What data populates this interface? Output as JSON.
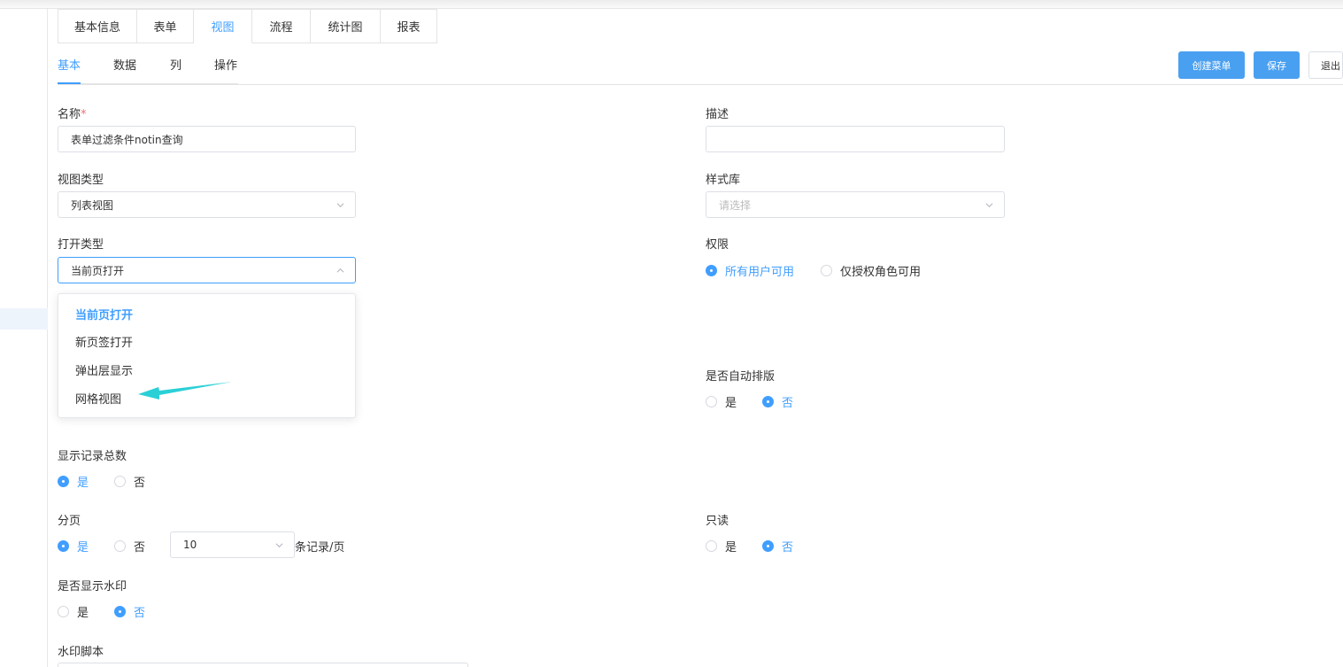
{
  "tabs": [
    "基本信息",
    "表单",
    "视图",
    "流程",
    "统计图",
    "报表"
  ],
  "active_tab": "视图",
  "subtabs": [
    "基本",
    "数据",
    "列",
    "操作"
  ],
  "active_subtab": "基本",
  "actions": {
    "create_menu": "创建菜单",
    "save": "保存",
    "exit": "退出"
  },
  "form": {
    "name_label": "名称",
    "name_required_mark": "*",
    "name_value": "表单过滤条件notin查询",
    "desc_label": "描述",
    "desc_value": "",
    "view_type_label": "视图类型",
    "view_type_value": "列表视图",
    "style_lib_label": "样式库",
    "style_lib_placeholder": "请选择",
    "open_type_label": "打开类型",
    "open_type_value": "当前页打开",
    "permission_label": "权限",
    "permission_options": [
      "所有用户可用",
      "仅授权角色可用"
    ],
    "auto_layout_label": "是否自动排版",
    "show_total_label": "显示记录总数",
    "paging_label": "分页",
    "page_size_value": "10",
    "page_size_suffix": "条记录/页",
    "readonly_label": "只读",
    "watermark_label": "是否显示水印",
    "watermark_script_label": "水印脚本",
    "yes": "是",
    "no": "否"
  },
  "open_type_options": [
    "当前页打开",
    "新页签打开",
    "弹出层显示",
    "网格视图"
  ],
  "colors": {
    "accent": "#409eff",
    "button": "#4aa0f0",
    "annotation_arrow": "#2ad0d6"
  }
}
